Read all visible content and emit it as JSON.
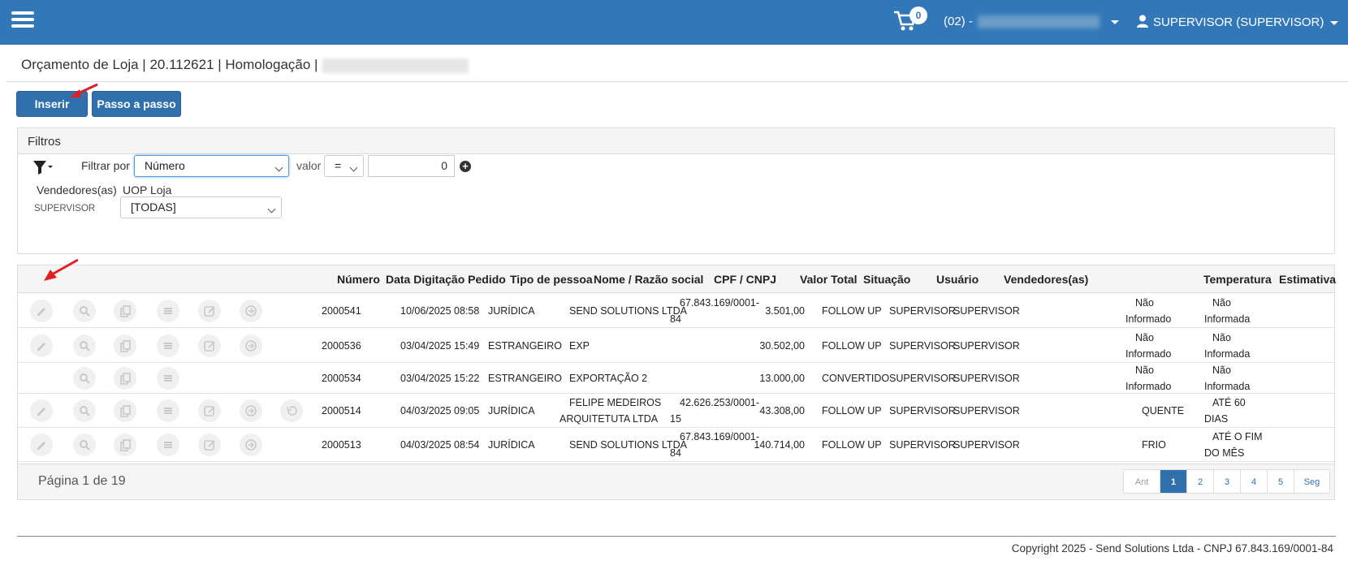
{
  "navbar": {
    "cart_count": "0",
    "store_label": "(02) -",
    "user_label": "SUPERVISOR (SUPERVISOR)"
  },
  "header": {
    "title": "Orçamento de Loja | 20.112621 | Homologação |"
  },
  "actions": {
    "insert_label": "Inserir",
    "step_label": "Passo a passo"
  },
  "filters": {
    "panel_title": "Filtros",
    "filter_by_label": "Filtrar por",
    "filter_by_value": "Número",
    "valor_label": "valor",
    "operator_value": "=",
    "value_input": "0",
    "sellers_label": "Vendedores(as)",
    "uop_label": "UOP Loja",
    "supervisor_label": "SUPERVISOR",
    "uop_value": "[TODAS]"
  },
  "table": {
    "columns": [
      "Número",
      "Data Digitação Pedido",
      "Tipo de pessoa",
      "Nome / Razão social",
      "CPF / CNPJ",
      "Valor Total",
      "Situação",
      "Usuário",
      "Vendedores(as)",
      "Temperatura",
      "Estimativa"
    ],
    "rows": [
      {
        "numero": "2000541",
        "data": "10/06/2025 08:58",
        "tipo": "JURÍDICA",
        "nome1": "SEND SOLUTIONS LTDA",
        "nome2": "",
        "cnpj1": "67.843.169/0001-",
        "cnpj2": "84",
        "valor": "3.501,00",
        "situacao": "FOLLOW UP",
        "usuario": "SUPERVISOR",
        "vendedor": "SUPERVISOR",
        "temp1": "Não",
        "temp2": "Informado",
        "est1": "Não",
        "est2": "Informada"
      },
      {
        "numero": "2000536",
        "data": "03/04/2025 15:49",
        "tipo": "ESTRANGEIRO",
        "nome1": "EXP",
        "nome2": "",
        "cnpj1": "",
        "cnpj2": "",
        "valor": "30.502,00",
        "situacao": "FOLLOW UP",
        "usuario": "SUPERVISOR",
        "vendedor": "SUPERVISOR",
        "temp1": "Não",
        "temp2": "Informado",
        "est1": "Não",
        "est2": "Informada"
      },
      {
        "numero": "2000534",
        "data": "03/04/2025 15:22",
        "tipo": "ESTRANGEIRO",
        "nome1": "EXPORTAÇÃO 2",
        "nome2": "",
        "cnpj1": "",
        "cnpj2": "",
        "valor": "13.000,00",
        "situacao": "CONVERTIDO",
        "usuario": "SUPERVISOR",
        "vendedor": "SUPERVISOR",
        "temp1": "Não",
        "temp2": "Informado",
        "est1": "Não",
        "est2": "Informada"
      },
      {
        "numero": "2000514",
        "data": "04/03/2025 09:05",
        "tipo": "JURÍDICA",
        "nome1": "FELIPE MEDEIROS",
        "nome2": "ARQUITETUTA LTDA",
        "cnpj1": "42.626.253/0001-",
        "cnpj2": "15",
        "valor": "43.308,00",
        "situacao": "FOLLOW UP",
        "usuario": "SUPERVISOR",
        "vendedor": "SUPERVISOR",
        "temp1": "QUENTE",
        "temp2": "",
        "est1": "ATÉ 60",
        "est2": "DIAS"
      },
      {
        "numero": "2000513",
        "data": "04/03/2025 08:54",
        "tipo": "JURÍDICA",
        "nome1": "SEND SOLUTIONS LTDA",
        "nome2": "",
        "cnpj1": "67.843.169/0001-",
        "cnpj2": "84",
        "valor": "140.714,00",
        "situacao": "FOLLOW UP",
        "usuario": "SUPERVISOR",
        "vendedor": "SUPERVISOR",
        "temp1": "FRIO",
        "temp2": "",
        "est1": "ATÉ O FIM",
        "est2": "DO MÊS"
      }
    ]
  },
  "pagination": {
    "info": "Página 1 de 19",
    "prev": "Ant",
    "pages": [
      "1",
      "2",
      "3",
      "4",
      "5"
    ],
    "next": "Seg"
  },
  "footer": {
    "copyright": "Copyright 2025 - Send Solutions Ltda - CNPJ 67.843.169/0001-84"
  },
  "colors": {
    "brand": "#3278b8",
    "button": "#2f70ad",
    "annotation": "#e02020"
  }
}
